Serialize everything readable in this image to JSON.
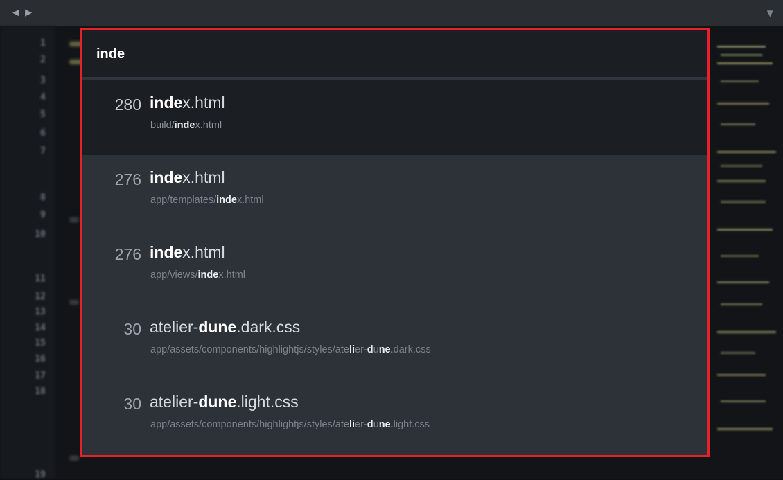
{
  "editor": {
    "line_numbers": [
      "1",
      "2",
      "3",
      "4",
      "5",
      "6",
      "7",
      "8",
      "9",
      "10",
      "11",
      "12",
      "13",
      "14",
      "15",
      "16",
      "17",
      "18",
      "19"
    ]
  },
  "finder": {
    "query": "inde",
    "results": [
      {
        "score": "280",
        "name": {
          "match": "inde",
          "rest": "x.html"
        },
        "path": {
          "pre": "build/",
          "match": "inde",
          "post": "x.html"
        }
      },
      {
        "score": "276",
        "name": {
          "match": "inde",
          "rest": "x.html"
        },
        "path": {
          "pre": "app/templates/",
          "match": "inde",
          "post": "x.html"
        }
      },
      {
        "score": "276",
        "name": {
          "match": "inde",
          "rest": "x.html"
        },
        "path": {
          "pre": "app/views/",
          "match": "inde",
          "post": "x.html"
        }
      },
      {
        "score": "30",
        "name": {
          "pre": "atelier-",
          "match": "dune",
          "rest": ".dark.css"
        },
        "path": {
          "pre": "app/assets/components/highlightjs/styles/ate",
          "m1": "li",
          "mid": "er-",
          "m2": "d",
          "mid2": "u",
          "m3": "ne",
          "post": ".dark.css"
        }
      },
      {
        "score": "30",
        "name": {
          "pre": "atelier-",
          "match": "dune",
          "rest": ".light.css"
        },
        "path": {
          "pre": "app/assets/components/highlightjs/styles/ate",
          "m1": "li",
          "mid": "er-",
          "m2": "d",
          "mid2": "u",
          "m3": "ne",
          "post": ".light.css"
        }
      }
    ]
  },
  "colors": {
    "highlight_border": "#e3222a",
    "panel_bg": "#2c3238",
    "selected_bg": "#1b1f24"
  }
}
